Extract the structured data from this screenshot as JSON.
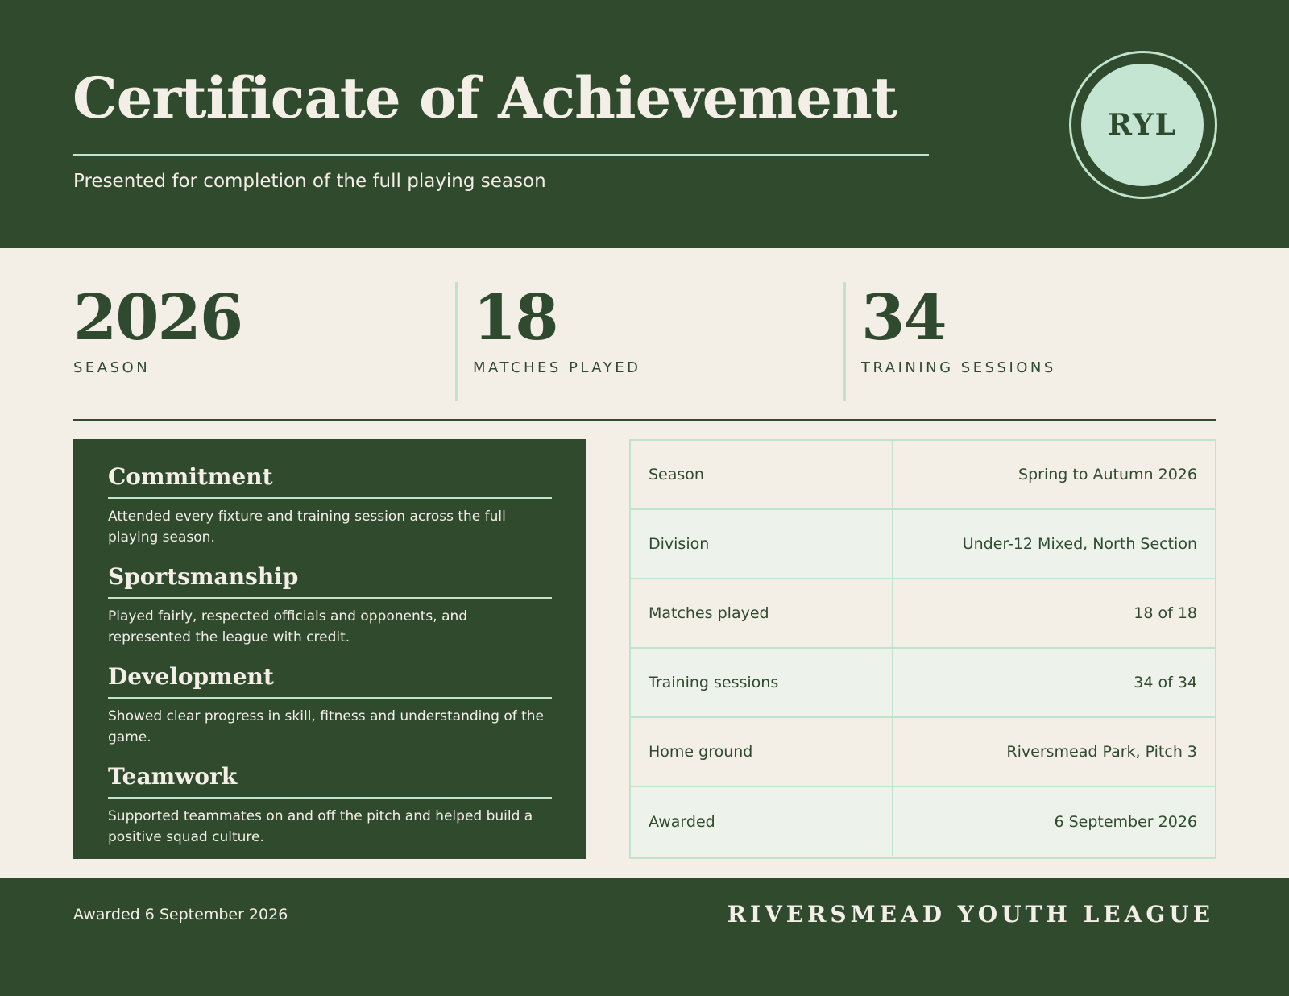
{
  "header": {
    "title": "Certificate of Achievement",
    "subtitle": "Presented for completion of the full playing season",
    "seal_text": "RYL"
  },
  "stats": [
    {
      "value": "2026",
      "label": "SEASON"
    },
    {
      "value": "18",
      "label": "MATCHES PLAYED"
    },
    {
      "value": "34",
      "label": "TRAINING SESSIONS"
    }
  ],
  "values": [
    {
      "heading": "Commitment",
      "text": "Attended every fixture and training session across the full playing season."
    },
    {
      "heading": "Sportsmanship",
      "text": "Played fairly, respected officials and opponents, and represented the league with credit."
    },
    {
      "heading": "Development",
      "text": "Showed clear progress in skill, fitness and understanding of the game."
    },
    {
      "heading": "Teamwork",
      "text": "Supported teammates on and off the pitch and helped build a positive squad culture."
    }
  ],
  "details": [
    {
      "label": "Season",
      "value": "Spring to Autumn 2026"
    },
    {
      "label": "Division",
      "value": "Under-12 Mixed, North Section"
    },
    {
      "label": "Matches played",
      "value": "18 of 18"
    },
    {
      "label": "Training sessions",
      "value": "34 of 34"
    },
    {
      "label": "Home ground",
      "value": "Riversmead Park, Pitch 3"
    },
    {
      "label": "Awarded",
      "value": "6 September 2026"
    }
  ],
  "footer": {
    "awarded": "Awarded 6 September 2026",
    "organization": "RIVERSMEAD YOUTH LEAGUE"
  },
  "colors": {
    "primary_green": "#304a2e",
    "accent_mint": "#bfe3cd",
    "paper": "#f3eee6"
  }
}
